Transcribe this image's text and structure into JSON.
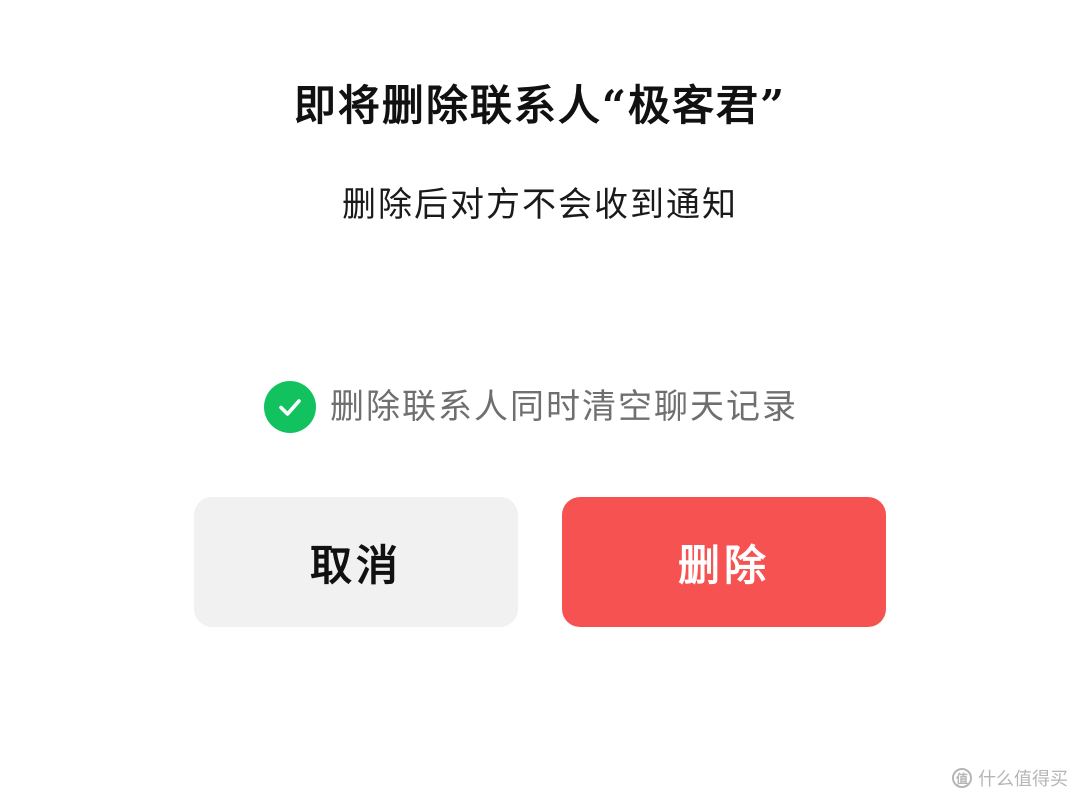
{
  "dialog": {
    "title": "即将删除联系人“极客君”",
    "subtitle": "删除后对方不会收到通知",
    "option": {
      "label": "删除联系人同时清空聊天记录",
      "checked": true,
      "icon": "check-circle-icon",
      "color": "#12c25f"
    },
    "buttons": {
      "cancel_label": "取消",
      "delete_label": "删除",
      "cancel_bg": "#f1f1f1",
      "delete_bg": "#f75252"
    }
  },
  "watermark": {
    "icon": "zhi-icon",
    "icon_text": "值",
    "text": "什么值得买"
  }
}
